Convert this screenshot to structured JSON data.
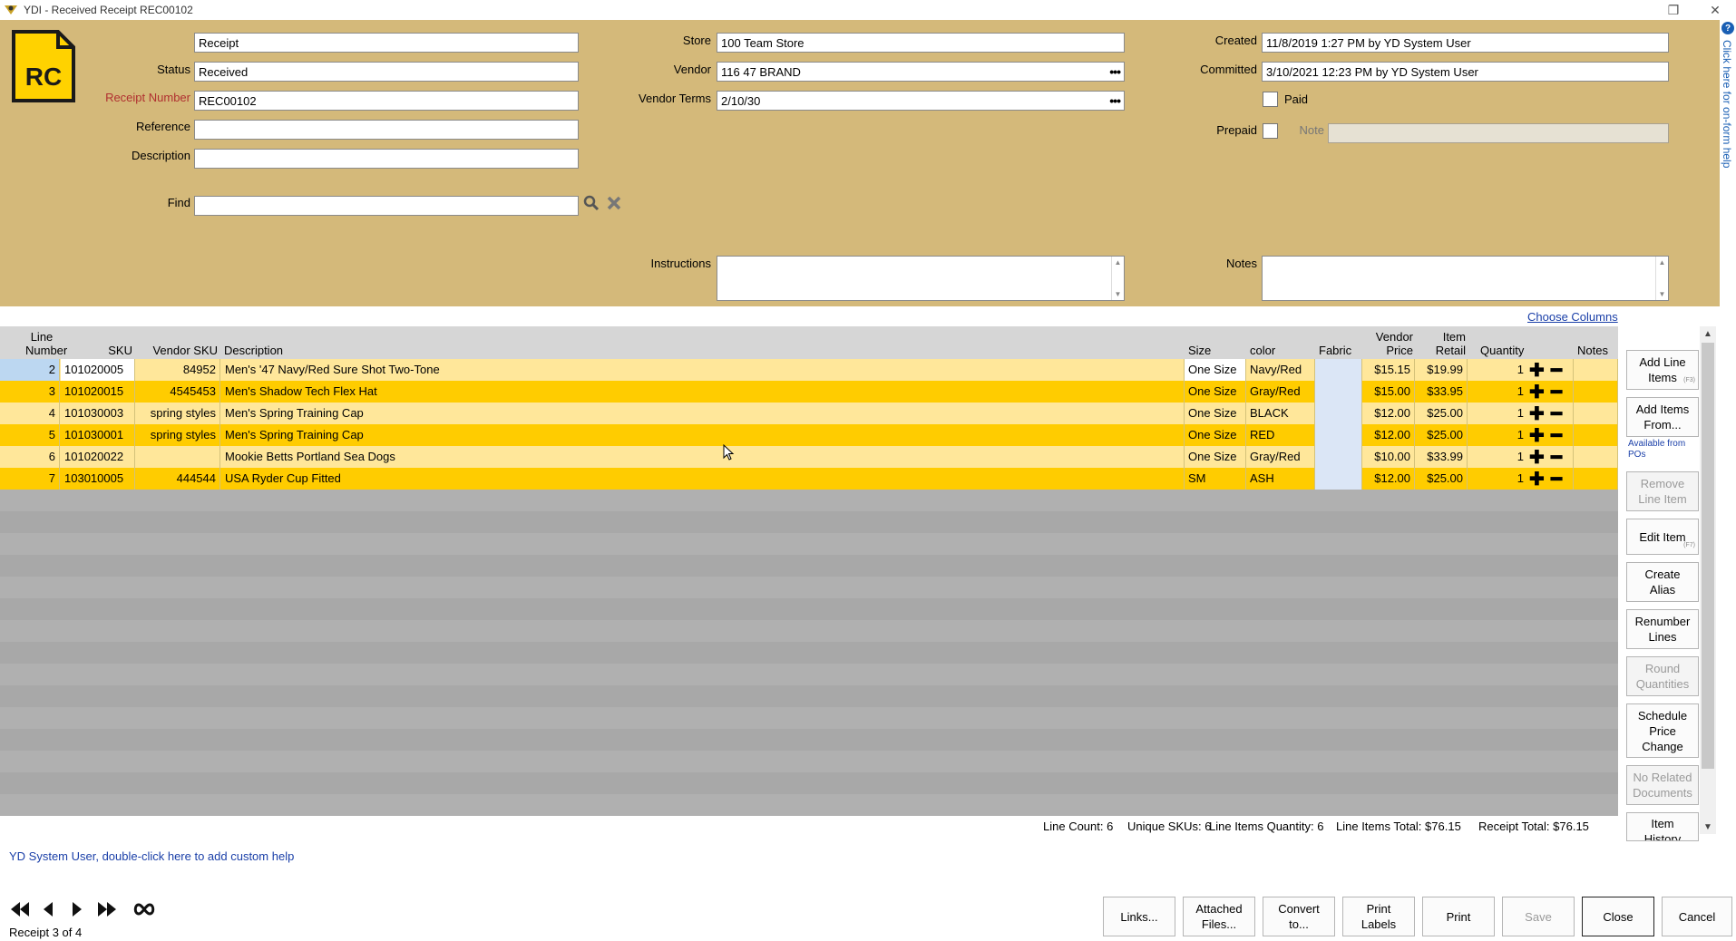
{
  "window": {
    "title": "YDI - Received Receipt REC00102"
  },
  "help_strip": {
    "text": "Click here for on-form help"
  },
  "header": {
    "logo_text": "RC",
    "type_value": "Receipt",
    "status_label": "Status",
    "status_value": "Received",
    "receipt_number_label": "Receipt Number",
    "receipt_number_value": "REC00102",
    "reference_label": "Reference",
    "reference_value": "",
    "description_label": "Description",
    "description_value": "",
    "find_label": "Find",
    "find_value": "",
    "store_label": "Store",
    "store_value": "100 Team Store",
    "vendor_label": "Vendor",
    "vendor_value": "116 47 BRAND",
    "vendor_terms_label": "Vendor Terms",
    "vendor_terms_value": "2/10/30",
    "instructions_label": "Instructions",
    "created_label": "Created",
    "created_value": "11/8/2019 1:27 PM by YD System User",
    "committed_label": "Committed",
    "committed_value": "3/10/2021 12:23 PM by YD System User",
    "paid_label": "Paid",
    "prepaid_label": "Prepaid",
    "note_label": "Note",
    "notes_label": "Notes"
  },
  "grid": {
    "choose_columns": "Choose Columns",
    "headers": {
      "line_number": [
        "Line",
        "Number"
      ],
      "sku": "SKU",
      "vendor_sku": "Vendor SKU",
      "description": "Description",
      "size": "Size",
      "color": "color",
      "fabric": "Fabric",
      "vendor_price": [
        "Vendor",
        "Price"
      ],
      "item_retail": [
        "Item",
        "Retail"
      ],
      "quantity": "Quantity",
      "notes": "Notes"
    },
    "rows": [
      {
        "line": "2",
        "sku": "101020005",
        "vendor_sku": "84952",
        "description": "Men's '47 Navy/Red Sure Shot Two-Tone",
        "size": "One Size",
        "color": "Navy/Red",
        "fabric": "",
        "vendor_price": "$15.15",
        "item_retail": "$19.99",
        "quantity": "1"
      },
      {
        "line": "3",
        "sku": "101020015",
        "vendor_sku": "4545453",
        "description": "Men's Shadow Tech Flex Hat",
        "size": "One Size",
        "color": "Gray/Red",
        "fabric": "",
        "vendor_price": "$15.00",
        "item_retail": "$33.95",
        "quantity": "1"
      },
      {
        "line": "4",
        "sku": "101030003",
        "vendor_sku": "spring styles",
        "description": "Men's Spring Training Cap",
        "size": "One Size",
        "color": "BLACK",
        "fabric": "",
        "vendor_price": "$12.00",
        "item_retail": "$25.00",
        "quantity": "1"
      },
      {
        "line": "5",
        "sku": "101030001",
        "vendor_sku": "spring styles",
        "description": "Men's Spring Training Cap",
        "size": "One Size",
        "color": "RED",
        "fabric": "",
        "vendor_price": "$12.00",
        "item_retail": "$25.00",
        "quantity": "1"
      },
      {
        "line": "6",
        "sku": "101020022",
        "vendor_sku": "",
        "description": "Mookie Betts Portland Sea Dogs",
        "size": "One Size",
        "color": "Gray/Red",
        "fabric": "",
        "vendor_price": "$10.00",
        "item_retail": "$33.99",
        "quantity": "1"
      },
      {
        "line": "7",
        "sku": "103010005",
        "vendor_sku": "444544",
        "description": "USA Ryder Cup Fitted",
        "size": "SM",
        "color": "ASH",
        "fabric": "",
        "vendor_price": "$12.00",
        "item_retail": "$25.00",
        "quantity": "1"
      }
    ]
  },
  "side_buttons": {
    "add_line_items": [
      "Add Line",
      "Items"
    ],
    "add_line_items_key": "(F3)",
    "add_items_from": [
      "Add Items",
      "From..."
    ],
    "available_from_pos": [
      "Available from",
      "POs"
    ],
    "remove_line_item": [
      "Remove",
      "Line Item"
    ],
    "edit_item": "Edit Item",
    "edit_item_key": "(F7)",
    "create_alias": [
      "Create",
      "Alias"
    ],
    "renumber_lines": [
      "Renumber",
      "Lines"
    ],
    "round_quantities": [
      "Round",
      "Quantities"
    ],
    "schedule_price_change": [
      "Schedule",
      "Price",
      "Change"
    ],
    "no_related_documents": [
      "No Related",
      "Documents"
    ],
    "item_history": [
      "Item",
      "History"
    ]
  },
  "totals": {
    "line_count": "Line Count: 6",
    "unique_skus": "Unique SKUs: 6",
    "line_items_quantity": "Line Items Quantity: 6",
    "line_items_total": "Line Items Total: $76.15",
    "receipt_total": "Receipt Total: $76.15"
  },
  "help_line": "YD System User, double-click here to add custom help",
  "footer": {
    "record_position": "Receipt 3 of 4",
    "links": "Links...",
    "attached_files": [
      "Attached",
      "Files..."
    ],
    "convert_to": [
      "Convert",
      "to..."
    ],
    "print_labels": [
      "Print",
      "Labels"
    ],
    "print": "Print",
    "save": "Save",
    "close": "Close",
    "cancel": "Cancel"
  },
  "colors": {
    "header_bg": "#d4b97a",
    "row_light": "#ffe79a",
    "row_dark": "#ffcc00",
    "link_blue": "#1a3fa8"
  }
}
